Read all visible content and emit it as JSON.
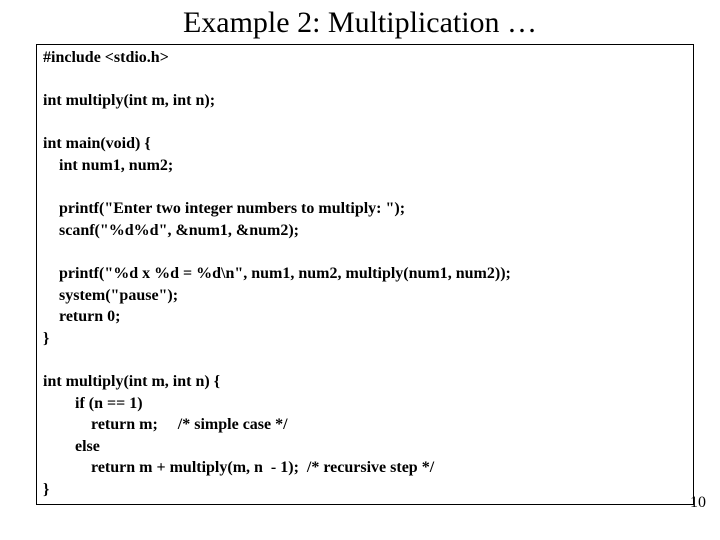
{
  "slide": {
    "title": "Example 2:  Multiplication …",
    "page_number": "10",
    "code": {
      "l01": "#include <stdio.h>",
      "l02": "",
      "l03": "int multiply(int m, int n);",
      "l04": "",
      "l05": "int main(void) {",
      "l06": "    int num1, num2;",
      "l07": "",
      "l08": "    printf(\"Enter two integer numbers to multiply: \");",
      "l09": "    scanf(\"%d%d\", &num1, &num2);",
      "l10": "",
      "l11": "    printf(\"%d x %d = %d\\n\", num1, num2, multiply(num1, num2));",
      "l12": "    system(\"pause\");",
      "l13": "    return 0;",
      "l14": "}",
      "l15": "",
      "l16": "int multiply(int m, int n) {",
      "l17": "        if (n == 1)",
      "l18": "            return m;     /* simple case */",
      "l19": "        else",
      "l20": "            return m + multiply(m, n  - 1);  /* recursive step */",
      "l21": "}"
    }
  }
}
